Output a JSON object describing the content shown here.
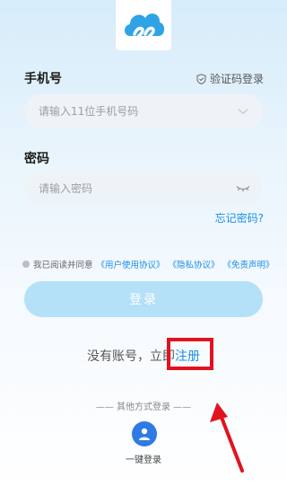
{
  "phone": {
    "label": "手机号",
    "switch_mode": "验证码登录",
    "placeholder": "请输入11位手机号码"
  },
  "password": {
    "label": "密码",
    "placeholder": "请输入密码"
  },
  "forgot_password": "忘记密码?",
  "agreement": {
    "prefix": "我已阅读并同意",
    "user_agreement": "《用户使用协议》",
    "privacy": "《隐私协议》",
    "disclaimer": "《免责声明》"
  },
  "login_button": "登录",
  "register": {
    "prefix": "没有账号，立即",
    "link": "注册"
  },
  "other_login": {
    "title": "—— 其他方式登录 ——",
    "one_key": "一键登录"
  },
  "colors": {
    "accent": "#1a8ee8",
    "button_disabled": "#b4e0f8",
    "highlight": "#e3121f"
  },
  "icons": [
    "cloud-logo-icon",
    "shield-icon",
    "chevron-down-icon",
    "eye-closed-icon",
    "user-icon",
    "arrow-icon"
  ]
}
